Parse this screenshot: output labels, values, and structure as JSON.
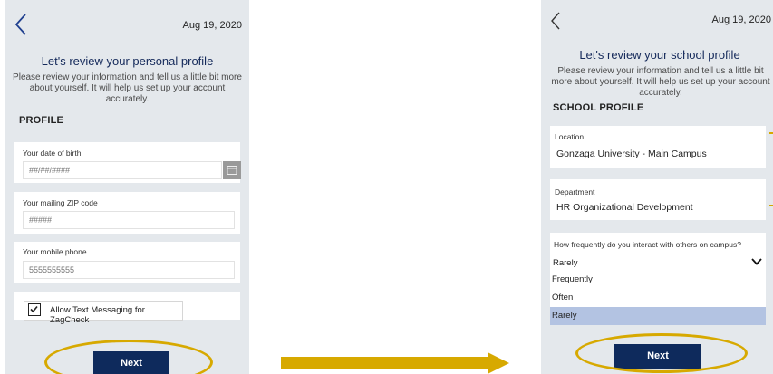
{
  "left": {
    "date": "Aug 19, 2020",
    "title": "Let's review your personal profile",
    "description": "Please review your information and tell us a little bit more about yourself. It will help us set up your account accurately.",
    "section": "PROFILE",
    "fields": {
      "dob": {
        "label": "Your date of birth",
        "placeholder": "##/##/####"
      },
      "zip": {
        "label": "Your mailing ZIP code",
        "placeholder": "#####"
      },
      "phone": {
        "label": "Your mobile phone",
        "placeholder": "5555555555"
      }
    },
    "checkbox_label": "Allow Text Messaging for ZagCheck",
    "checkbox_checked": true,
    "next_label": "Next"
  },
  "right": {
    "date": "Aug 19, 2020",
    "title": "Let's review your school profile",
    "description": "Please review your information and tell us a little bit more about yourself. It will help us set up your account accurately.",
    "section": "SCHOOL PROFILE",
    "location": {
      "label": "Location",
      "value": "Gonzaga University - Main Campus"
    },
    "department": {
      "label": "Department",
      "value": "HR Organizational Development"
    },
    "interaction": {
      "label": "How frequently do you interact with others on campus?",
      "selected": "Rarely",
      "options": [
        "Frequently",
        "Often",
        "Rarely"
      ]
    },
    "next_label": "Next"
  },
  "colors": {
    "accent_navy": "#0e2a5c",
    "highlight_gold": "#d7a900",
    "screen_bg": "#e4e8ec",
    "selected_option": "#b3c3e2"
  },
  "icons": [
    "back-chevron-icon",
    "calendar-icon",
    "checkmark-icon",
    "chevron-down-icon",
    "arrow-right-icon"
  ]
}
